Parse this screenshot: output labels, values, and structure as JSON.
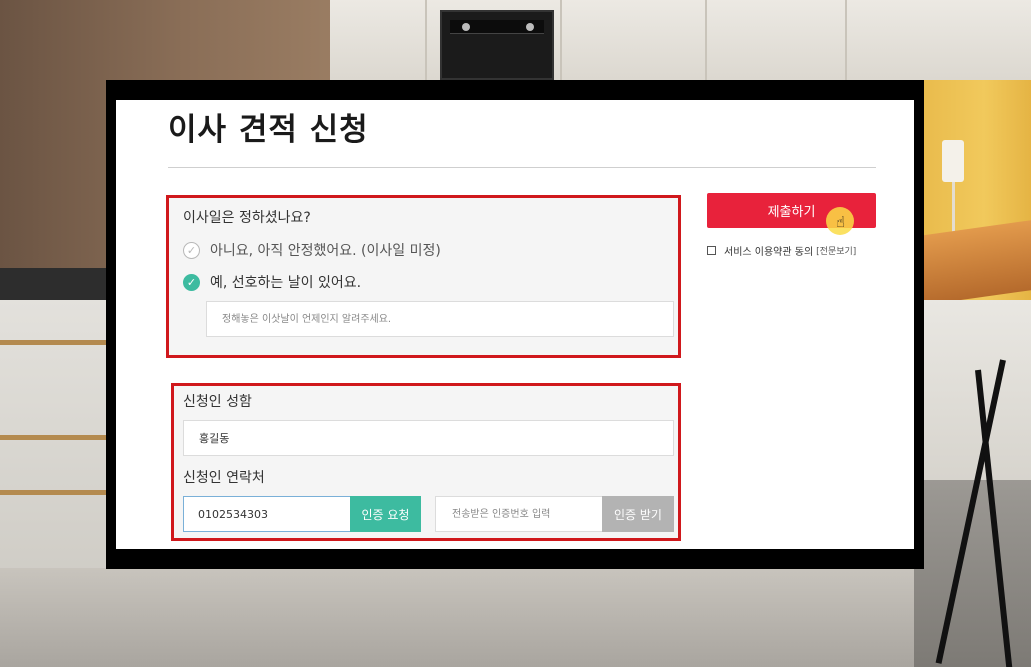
{
  "page": {
    "title": "이사 견적 신청"
  },
  "move_date": {
    "question": "이사일은 정하셨나요?",
    "options": [
      {
        "label": "아니요, 아직 안정했어요. (이사일 미정)",
        "selected": false
      },
      {
        "label": "예, 선호하는 날이 있어요.",
        "selected": true
      }
    ],
    "date_placeholder": "정해놓은 이삿날이 언제인지 알려주세요."
  },
  "applicant": {
    "name_label": "신청인 성함",
    "name_value": "홍길동",
    "phone_label": "신청인 연락처",
    "phone_value": "0102534303",
    "verify_request_label": "인증 요청",
    "code_placeholder": "전송받은 인증번호 입력",
    "verify_receive_label": "인증 받기"
  },
  "actions": {
    "submit_label": "제출하기",
    "agree_label": "서비스 이용약관 동의",
    "agree_link": "[전문보기]",
    "agree_checked": false
  },
  "colors": {
    "accent_green": "#3dbba0",
    "submit_red": "#e8223b",
    "highlight_border": "#d0181c"
  },
  "icons": {
    "check_radio": "✓",
    "cursor": "☝"
  }
}
